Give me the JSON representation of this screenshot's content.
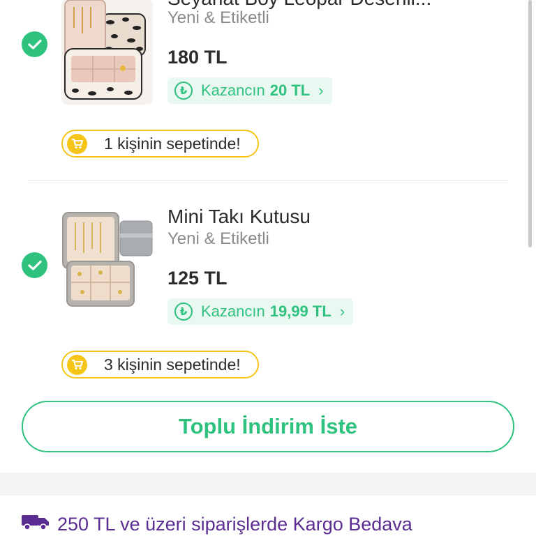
{
  "items": [
    {
      "title": "Seyahat Boy Leopar Desenli...",
      "condition": "Yeni & Etiketli",
      "price": "180 TL",
      "earning_label": "Kazancın",
      "earning_amount": "20 TL",
      "basket_text": "1 kişinin sepetinde!",
      "selected": true
    },
    {
      "title": "Mini Takı Kutusu",
      "condition": "Yeni & Etiketli",
      "price": "125 TL",
      "earning_label": "Kazancın",
      "earning_amount": "19,99 TL",
      "basket_text": "3 kişinin sepetinde!",
      "selected": true
    }
  ],
  "bulk_button_label": "Toplu İndirim İste",
  "shipping_banner": "250 TL ve üzeri siparişlerde Kargo Bedava",
  "icons": {
    "check": "check-icon",
    "lira_coin": "lira-coin-icon",
    "chevron": "chevron-right-icon",
    "cart": "cart-icon",
    "truck": "truck-icon"
  },
  "colors": {
    "green": "#2ec27e",
    "yellow": "#f5c518",
    "purple": "#5a2d91"
  }
}
